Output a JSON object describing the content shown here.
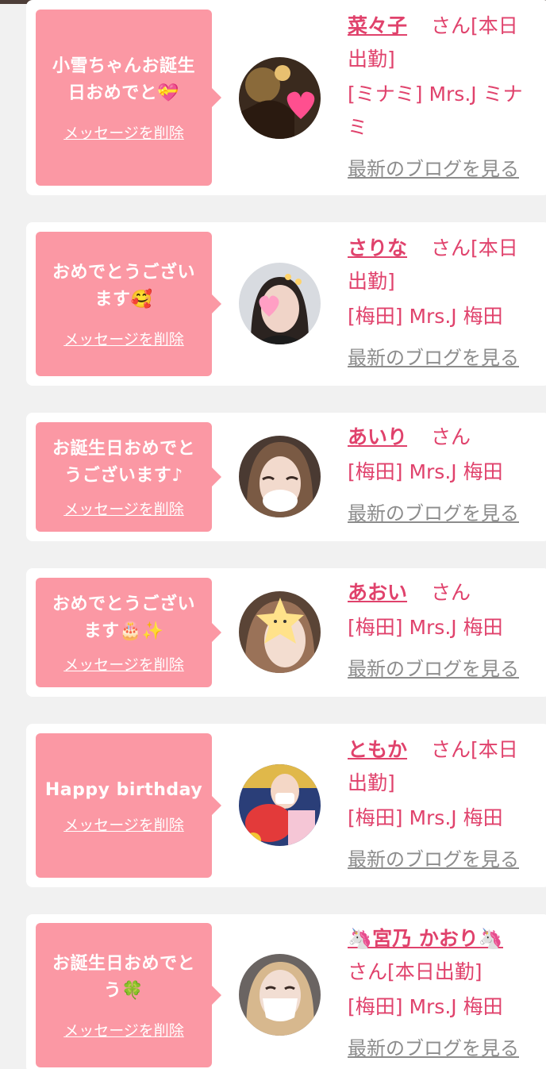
{
  "delete_label": "メッセージを削除",
  "blog_label": "最新のブログを見る",
  "san_label": "さん",
  "colors": {
    "bubble": "#fb98a4",
    "accent": "#e0426c",
    "link_gray": "#8c8c8c",
    "background": "#f1f1f1"
  },
  "cards": [
    {
      "message_lines": [
        "小雪ちゃんお誕生",
        "日おめでと💝"
      ],
      "name": "菜々子",
      "status_lines": [
        "さん[本日",
        "出勤]"
      ],
      "shop_lines": [
        "[ミナミ] Mrs.J ミナ",
        "ミ"
      ]
    },
    {
      "message_lines": [
        "おめでとうござい",
        "ます🥰"
      ],
      "name": "さりな",
      "status_lines": [
        "さん[本日",
        "出勤]"
      ],
      "shop_lines": [
        "[梅田] Mrs.J 梅田"
      ]
    },
    {
      "message_lines": [
        "お誕生日おめでと",
        "うございます♪"
      ],
      "name": "あいり",
      "status_lines": [
        "さん"
      ],
      "shop_lines": [
        "[梅田] Mrs.J 梅田"
      ]
    },
    {
      "message_lines": [
        "おめでとうござい",
        "ます🎂✨"
      ],
      "name": "あおい",
      "status_lines": [
        "さん"
      ],
      "shop_lines": [
        "[梅田] Mrs.J 梅田"
      ]
    },
    {
      "message_lines": [
        "Happy birthday"
      ],
      "name": "ともか",
      "status_lines": [
        "さん[本日",
        "出勤]"
      ],
      "shop_lines": [
        "[梅田] Mrs.J 梅田"
      ]
    },
    {
      "message_lines": [
        "お誕生日おめでと",
        "う🍀"
      ],
      "name": "🦄宮乃 かおり🦄",
      "status_lines": [
        "さん[本日出勤]"
      ],
      "shop_lines": [
        "[梅田] Mrs.J 梅田"
      ]
    }
  ]
}
